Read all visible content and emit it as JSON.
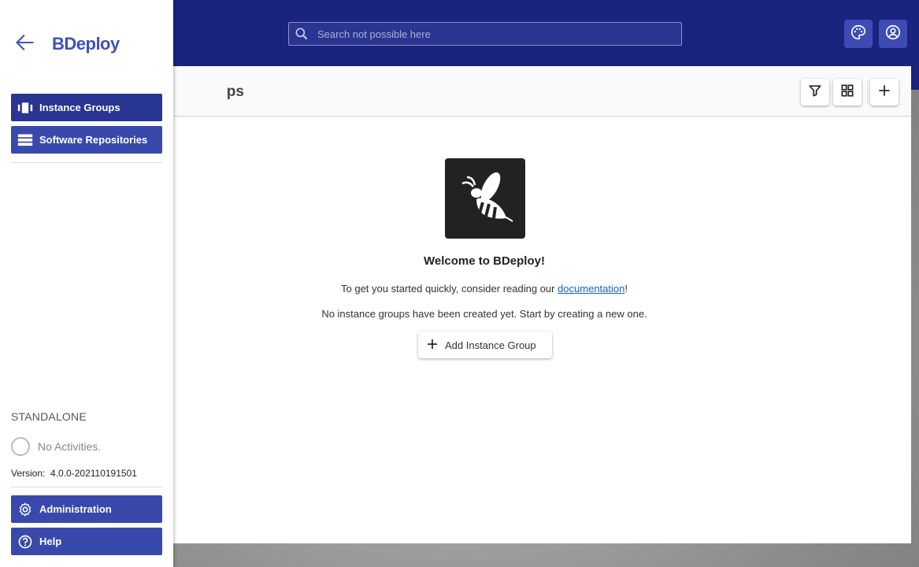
{
  "app": {
    "title": "BDeploy"
  },
  "search": {
    "placeholder": "Search not possible here"
  },
  "topbar": {
    "theme_icon": "palette-icon",
    "user_icon": "account-circle-icon"
  },
  "sidebar": {
    "items": [
      {
        "label": "Instance Groups",
        "icon": "view-carousel-icon",
        "active": true
      },
      {
        "label": "Software Repositories",
        "icon": "storage-icon",
        "active": false
      }
    ],
    "mode": "STANDALONE",
    "activities": "No Activities.",
    "version_label": "Version:",
    "version_value": "4.0.0-202110191501",
    "bottom_items": [
      {
        "label": "Administration",
        "icon": "settings-icon"
      },
      {
        "label": "Help",
        "icon": "help-icon"
      }
    ]
  },
  "main": {
    "title_partial": "ps",
    "welcome": "Welcome to BDeploy!",
    "intro_prefix": "To get you started quickly, consider reading our ",
    "intro_link": "documentation",
    "intro_suffix": "!",
    "empty_message": "No instance groups have been created yet. Start by creating a new one.",
    "add_button": "Add Instance Group"
  },
  "colors": {
    "primary": "#1a237e",
    "nav": "#3949ab",
    "accent": "#3f51b5"
  }
}
